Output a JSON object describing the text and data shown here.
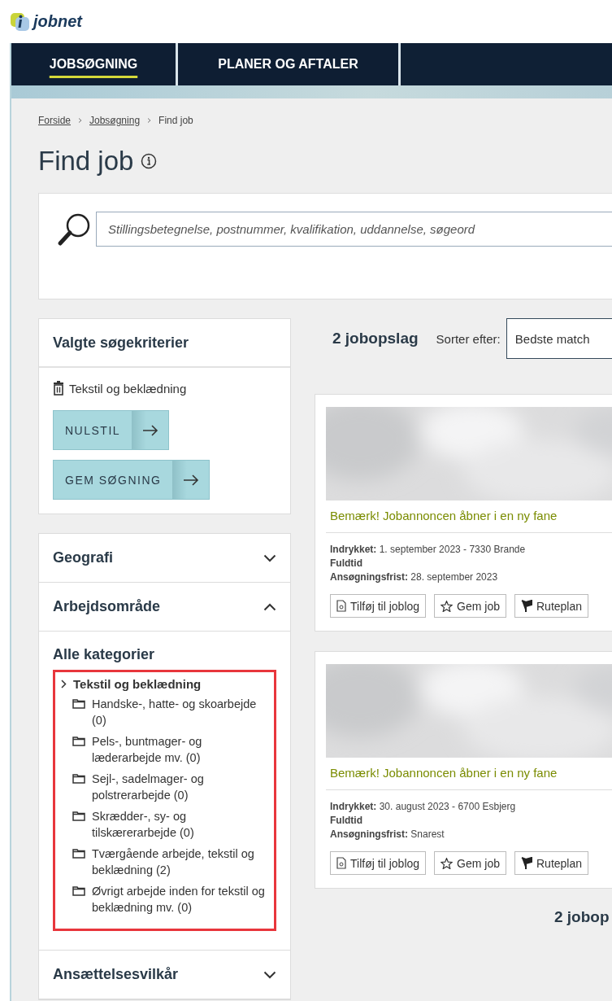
{
  "logo": {
    "text": "jobnet"
  },
  "nav": {
    "tabs": [
      {
        "label": "JOBSØGNING",
        "selected": true
      },
      {
        "label": "PLANER OG AFTALER",
        "selected": false
      }
    ]
  },
  "breadcrumb": [
    {
      "label": "Forside",
      "link": true
    },
    {
      "label": "Jobsøgning",
      "link": true
    },
    {
      "label": "Find job",
      "link": false
    }
  ],
  "title": "Find job",
  "search": {
    "placeholder": "Stillingsbetegnelse, postnummer, kvalifikation, uddannelse, søgeord"
  },
  "criteria": {
    "title": "Valgte søgekriterier",
    "items": [
      "Tekstil og beklædning"
    ],
    "buttons": [
      "NULSTIL",
      "GEM SØGNING"
    ]
  },
  "filters": [
    {
      "title": "Geografi",
      "expanded": false
    },
    {
      "title": "Arbejdsområde",
      "expanded": true,
      "subtitle": "Alle kategorier",
      "tree": [
        {
          "label": "Tekstil og beklædning",
          "highlighted": true,
          "children": [
            {
              "label": "Handske-, hatte- og skoarbejde (0)"
            },
            {
              "label": "Pels-, buntmager- og læderarbejde mv. (0)"
            },
            {
              "label": "Sejl-, sadelmager- og polstrerarbejde (0)"
            },
            {
              "label": "Skrædder-, sy- og tilskærerarbejde (0)"
            },
            {
              "label": "Tværgående arbejde, tekstil og beklædning (2)"
            },
            {
              "label": "Øvrigt arbejde inden for tekstil og beklædning mv. (0)"
            }
          ]
        }
      ]
    },
    {
      "title": "Ansættelsesvilkår",
      "expanded": false
    }
  ],
  "results": {
    "count": "2 jobopslag",
    "sort_label": "Sorter efter:",
    "sort_value": "Bedste match",
    "jobs": [
      {
        "notice": "Bemærk! Jobannoncen åbner i en ny fane",
        "posted": "**Indrykket:** 1. september 2023 - 7330 Brande",
        "type": "Fuldtid",
        "deadline": "**Ansøgningsfrist:** 28. september 2023",
        "actions": [
          {
            "kind": "joblog",
            "label": "Tilføj til joblog"
          },
          {
            "kind": "save",
            "label": "Gem job"
          },
          {
            "kind": "route",
            "label": "Ruteplan"
          }
        ]
      },
      {
        "notice": "Bemærk! Jobannoncen åbner i en ny fane",
        "posted": "**Indrykket:** 30. august 2023 - 6700 Esbjerg",
        "type": "Fuldtid",
        "deadline": "**Ansøgningsfrist:** Snarest",
        "actions": [
          {
            "kind": "joblog",
            "label": "Tilføj til joblog"
          },
          {
            "kind": "save",
            "label": "Gem job"
          },
          {
            "kind": "route",
            "label": "Ruteplan"
          }
        ]
      }
    ],
    "footer_count": "2 jobop"
  }
}
